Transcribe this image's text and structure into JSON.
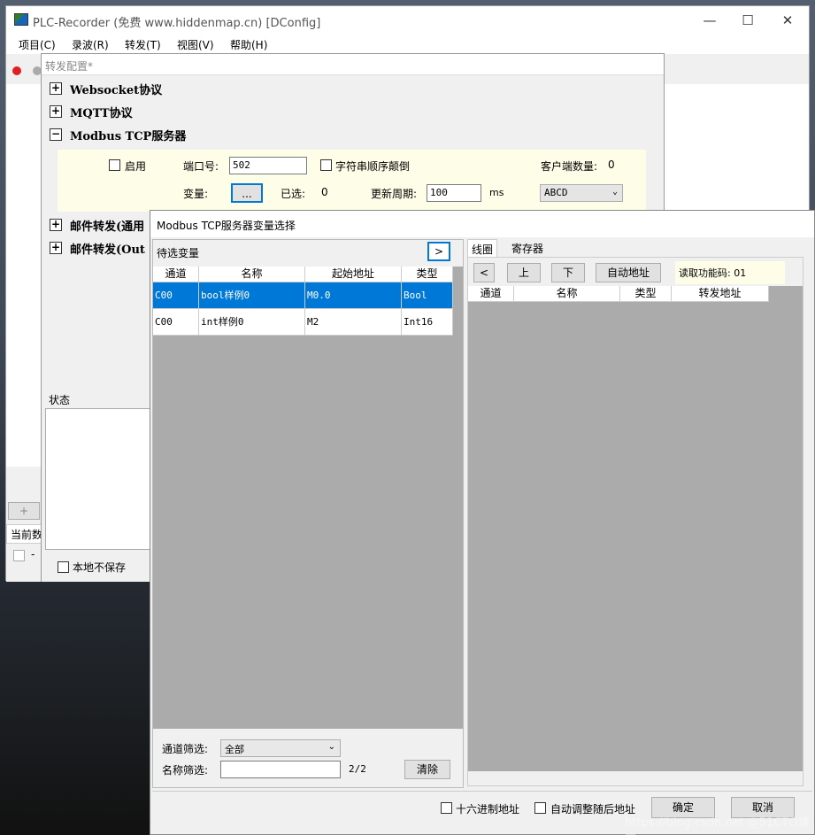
{
  "window": {
    "title": "PLC-Recorder (免费 www.hiddenmap.cn) [DConfig]",
    "minimize": "—",
    "maximize": "☐",
    "close": "✕"
  },
  "menu": {
    "items": [
      "项目(C)",
      "录波(R)",
      "转发(T)",
      "视图(V)",
      "帮助(H)"
    ]
  },
  "sidebar": {
    "plus": "+",
    "current_label": "当前数",
    "dash": "-"
  },
  "config": {
    "title": "转发配置*",
    "tree": [
      {
        "toggle": "+",
        "label": "Websocket协议"
      },
      {
        "toggle": "+",
        "label": "MQTT协议"
      },
      {
        "toggle": "−",
        "label": "Modbus TCP服务器"
      },
      {
        "toggle": "+",
        "label": "邮件转发(通用"
      },
      {
        "toggle": "+",
        "label": "邮件转发(Out"
      }
    ],
    "enable_label": "启用",
    "port_label": "端口号:",
    "port_value": "502",
    "reverse_label": "字符串顺序颠倒",
    "clients_label": "客户端数量:",
    "clients_value": "0",
    "var_label": "变量:",
    "var_button": "...",
    "selected_label": "已选:",
    "selected_value": "0",
    "period_label": "更新周期:",
    "period_value": "100",
    "period_unit": "ms",
    "byte_order": "ABCD",
    "status_label": "状态",
    "no_save_label": "本地不保存"
  },
  "dialog": {
    "title": "Modbus TCP服务器变量选择",
    "candidates_label": "待选变量",
    "move_button": ">",
    "columns": [
      "通道",
      "名称",
      "起始地址",
      "类型"
    ],
    "rows": [
      {
        "channel": "C00",
        "name": "bool样例0",
        "address": "M0.0",
        "type": "Bool"
      },
      {
        "channel": "C00",
        "name": "int样例0",
        "address": "M2",
        "type": "Int16"
      }
    ],
    "channel_filter_label": "通道筛选:",
    "channel_filter_value": "全部",
    "name_filter_label": "名称筛选:",
    "name_filter_value": "",
    "count": "2/2",
    "clear_button": "清除",
    "tabs": [
      "线圈",
      "寄存器"
    ],
    "nav": {
      "prev": "<",
      "up": "上",
      "down": "下",
      "auto_addr": "自动地址"
    },
    "read_func_label": "读取功能码: 01",
    "right_columns": [
      "通道",
      "名称",
      "类型",
      "转发地址"
    ],
    "hex_label": "十六进制地址",
    "auto_adjust_label": "自动调整随后地址",
    "ok_button": "确定",
    "cancel_button": "取消"
  },
  "watermark": "https://blog.csdn.net @51CTO博客"
}
